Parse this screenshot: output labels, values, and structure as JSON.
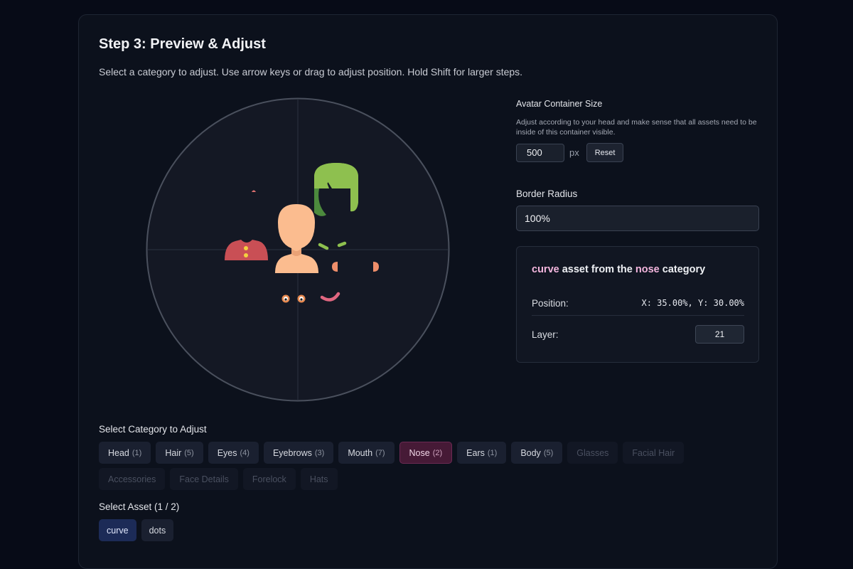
{
  "step": {
    "title": "Step 3: Preview & Adjust",
    "subtitle": "Select a category to adjust. Use arrow keys or drag to adjust position. Hold Shift for larger steps."
  },
  "container_size": {
    "label": "Avatar Container Size",
    "help": "Adjust according to your head and make sense that all assets need to be inside of this container visible.",
    "value": "500",
    "unit": "px",
    "reset_label": "Reset"
  },
  "border_radius": {
    "label": "Border Radius",
    "value": "100%"
  },
  "selected_asset": {
    "asset_name": "curve",
    "text_middle": "asset from the",
    "category_name": "nose",
    "text_end": "category",
    "position_label": "Position:",
    "position_value": "X: 35.00%, Y: 30.00%",
    "layer_label": "Layer:",
    "layer_value": "21"
  },
  "categories": {
    "label": "Select Category to Adjust",
    "items": [
      {
        "name": "Head",
        "count": "(1)",
        "state": "normal"
      },
      {
        "name": "Hair",
        "count": "(5)",
        "state": "normal"
      },
      {
        "name": "Eyes",
        "count": "(4)",
        "state": "normal"
      },
      {
        "name": "Eyebrows",
        "count": "(3)",
        "state": "normal"
      },
      {
        "name": "Mouth",
        "count": "(7)",
        "state": "normal"
      },
      {
        "name": "Nose",
        "count": "(2)",
        "state": "active"
      },
      {
        "name": "Ears",
        "count": "(1)",
        "state": "normal"
      },
      {
        "name": "Body",
        "count": "(5)",
        "state": "normal"
      },
      {
        "name": "Glasses",
        "count": "",
        "state": "disabled"
      },
      {
        "name": "Facial Hair",
        "count": "",
        "state": "disabled"
      },
      {
        "name": "Accessories",
        "count": "",
        "state": "disabled"
      },
      {
        "name": "Face Details",
        "count": "",
        "state": "disabled"
      },
      {
        "name": "Forelock",
        "count": "",
        "state": "disabled"
      },
      {
        "name": "Hats",
        "count": "",
        "state": "disabled"
      }
    ]
  },
  "assets": {
    "label": "Select Asset (1 / 2)",
    "items": [
      {
        "name": "curve",
        "selected": true
      },
      {
        "name": "dots",
        "selected": false
      }
    ]
  },
  "colors": {
    "background": "#070b17",
    "card": "#0c111c",
    "accent_pink": "#f4b6de",
    "active_chip": "#461a36",
    "selected_asset": "#1c2b57",
    "skin": "#fbbc8f",
    "hair": "#8ec04f",
    "shirt": "#c94f55"
  }
}
